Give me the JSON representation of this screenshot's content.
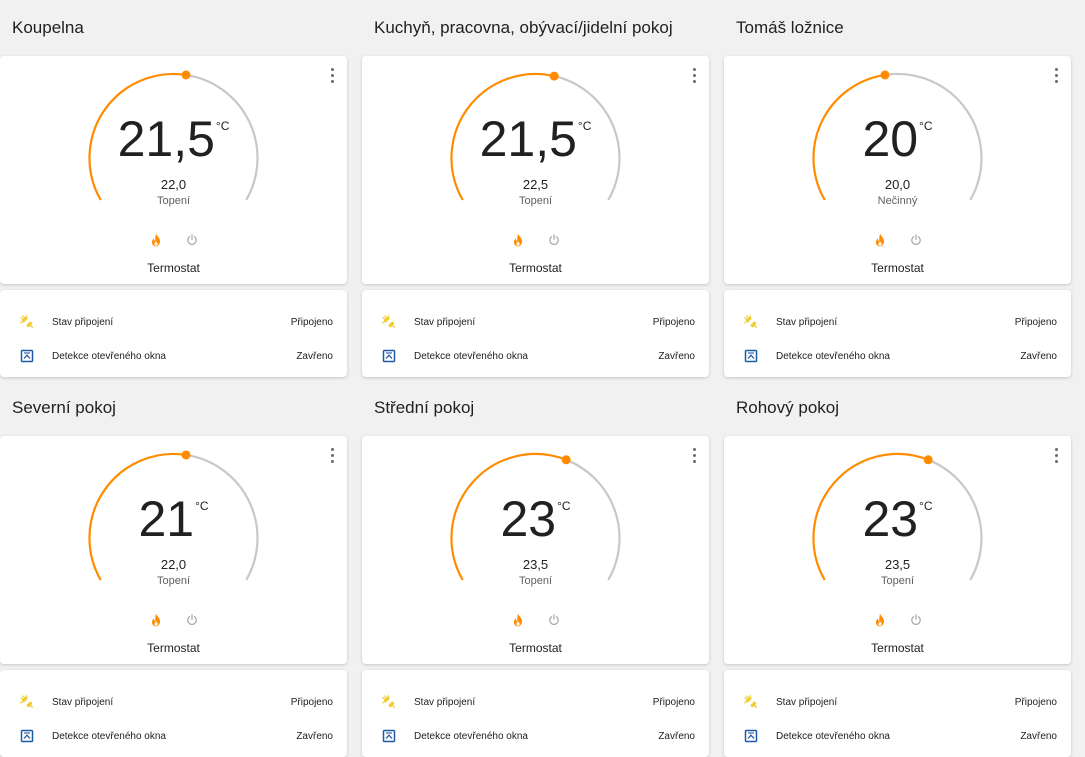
{
  "colors": {
    "heat": "#ff8c00",
    "track": "#c8c8c8",
    "window_icon": "#1e5aa8",
    "plug_icon": "#f0cc30"
  },
  "icons": {
    "menu": "dots-vertical-icon",
    "heat_mode": "fire-icon",
    "off_mode": "power-icon",
    "connection": "plug-connected-icon",
    "window": "window-closed-icon"
  },
  "rooms": [
    {
      "title": "Koupelna",
      "current": "21,5",
      "unit": "°C",
      "target": "22,0",
      "action": "Topení",
      "name": "Termostat",
      "entities": [
        {
          "label": "Stav připojení",
          "state": "Připojeno"
        },
        {
          "label": "Detekce otevřeného okna",
          "state": "Zavřeno"
        }
      ]
    },
    {
      "title": "Kuchyň, pracovna, obývací/jidelní pokoj",
      "current": "21,5",
      "unit": "°C",
      "target": "22,5",
      "action": "Topení",
      "name": "Termostat",
      "entities": [
        {
          "label": "Stav připojení",
          "state": "Připojeno"
        },
        {
          "label": "Detekce otevřeného okna",
          "state": "Zavřeno"
        }
      ]
    },
    {
      "title": "Tomáš ložnice",
      "current": "20",
      "unit": "°C",
      "target": "20,0",
      "action": "Nečinný",
      "name": "Termostat",
      "entities": [
        {
          "label": "Stav připojení",
          "state": "Připojeno"
        },
        {
          "label": "Detekce otevřeného okna",
          "state": "Zavřeno"
        }
      ]
    },
    {
      "title": "Severní pokoj",
      "current": "21",
      "unit": "°C",
      "target": "22,0",
      "action": "Topení",
      "name": "Termostat",
      "entities": [
        {
          "label": "Stav připojení",
          "state": "Připojeno"
        },
        {
          "label": "Detekce otevřeného okna",
          "state": "Zavřeno"
        }
      ]
    },
    {
      "title": "Střední pokoj",
      "current": "23",
      "unit": "°C",
      "target": "23,5",
      "action": "Topení",
      "name": "Termostat",
      "entities": [
        {
          "label": "Stav připojení",
          "state": "Připojeno"
        },
        {
          "label": "Detekce otevřeného okna",
          "state": "Zavřeno"
        }
      ]
    },
    {
      "title": "Rohový pokoj",
      "current": "23",
      "unit": "°C",
      "target": "23,5",
      "action": "Topení",
      "name": "Termostat",
      "entities": [
        {
          "label": "Stav připojení",
          "state": "Připojeno"
        },
        {
          "label": "Detekce otevřeného okna",
          "state": "Zavřeno"
        }
      ]
    }
  ]
}
